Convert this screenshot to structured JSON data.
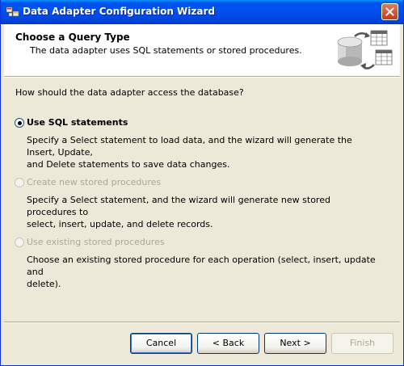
{
  "window": {
    "title": "Data Adapter Configuration Wizard"
  },
  "header": {
    "title": "Choose a Query Type",
    "subtitle": "The data adapter uses SQL statements or stored procedures."
  },
  "question": "How should the data adapter access the database?",
  "options": [
    {
      "label": "Use SQL statements",
      "checked": true,
      "enabled": true,
      "description_lines": [
        "Specify a Select statement to load data, and the wizard will generate the Insert, Update,",
        "and Delete statements to save data changes."
      ]
    },
    {
      "label": "Create new stored procedures",
      "checked": false,
      "enabled": false,
      "description_lines": [
        "Specify a Select statement, and the wizard will generate new stored procedures to",
        "select, insert, update, and delete records."
      ]
    },
    {
      "label": "Use existing stored procedures",
      "checked": false,
      "enabled": false,
      "description_lines": [
        "Choose an existing stored procedure for each operation (select, insert, update and",
        "delete)."
      ]
    }
  ],
  "buttons": {
    "cancel": "Cancel",
    "back": "< Back",
    "next": "Next >",
    "finish": "Finish"
  },
  "colors": {
    "titlebar": "#0053ee",
    "dialog_bg": "#ece9d8",
    "disabled_text": "#aca899"
  }
}
